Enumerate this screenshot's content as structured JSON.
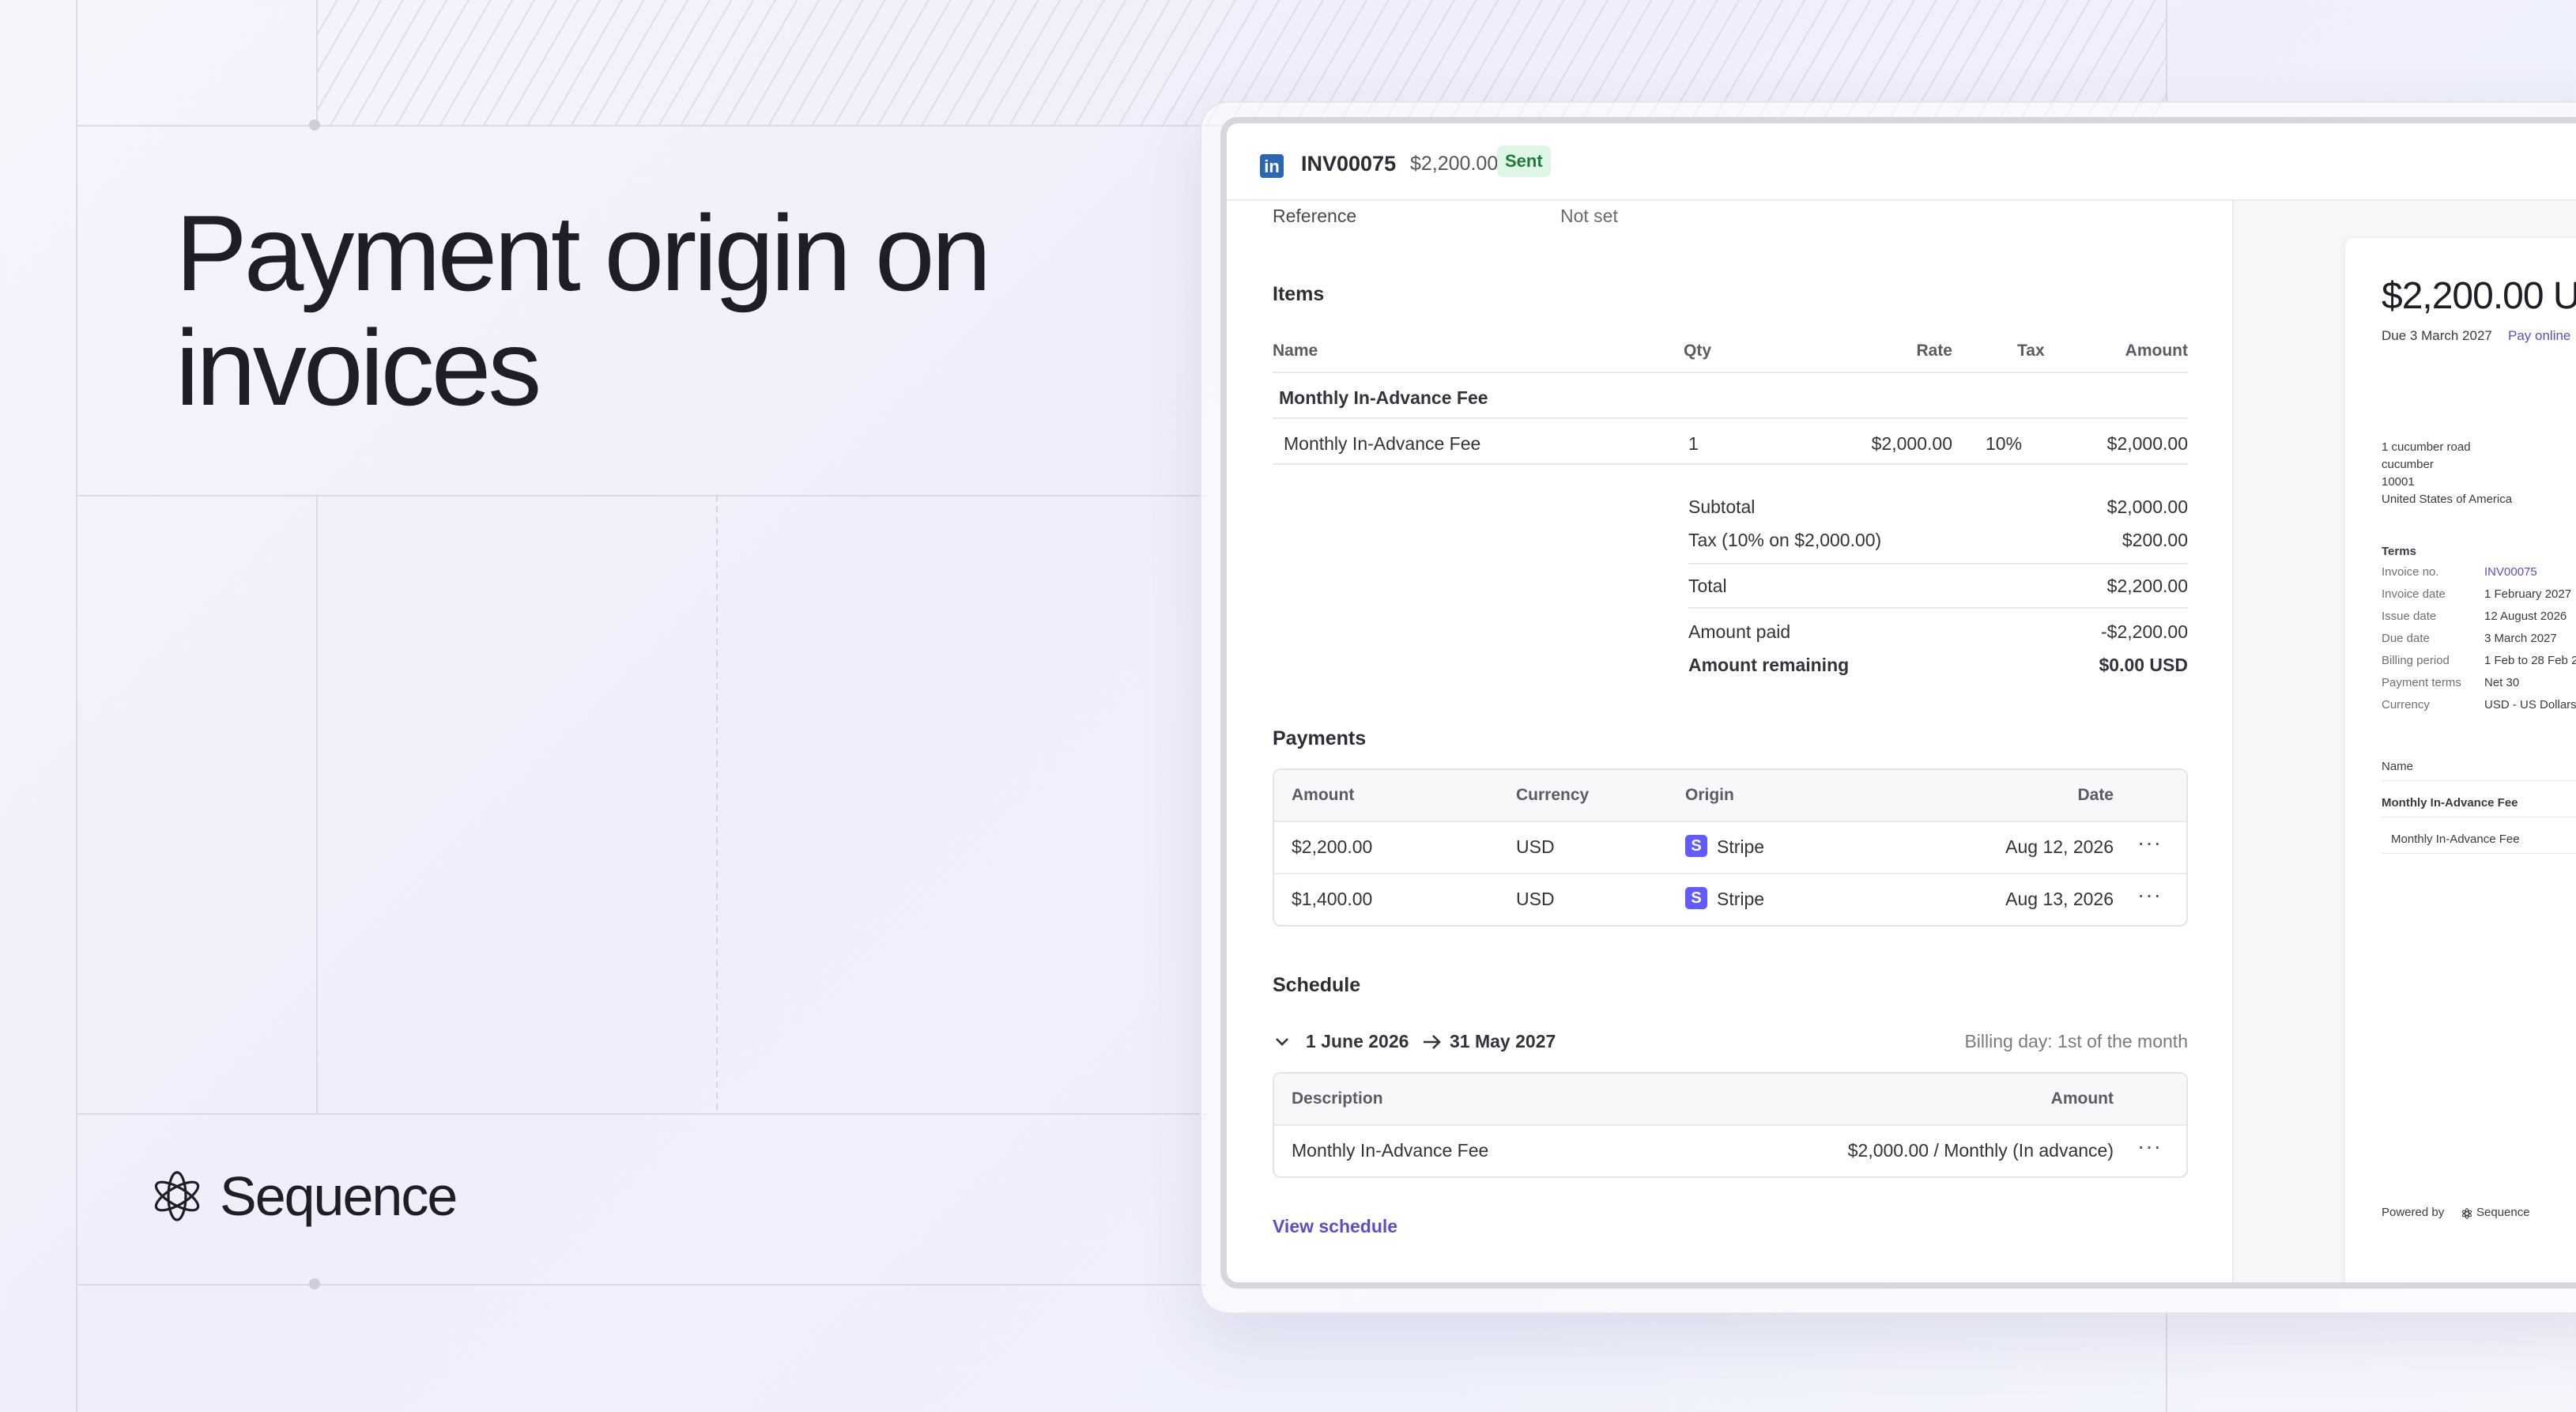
{
  "hero": {
    "title_line1": "Payment origin on",
    "title_line2": "invoices",
    "brand": "Sequence"
  },
  "invoice": {
    "number": "INV00075",
    "amount": "$2,200.00",
    "status": "Sent",
    "status_color": "#1f7a3d",
    "reference_label": "Reference",
    "reference_value": "Not set"
  },
  "items": {
    "heading": "Items",
    "columns": [
      "Name",
      "Qty",
      "Rate",
      "Tax",
      "Amount"
    ],
    "group_label": "Monthly In-Advance Fee",
    "rows": [
      {
        "name": "Monthly In-Advance Fee",
        "qty": "1",
        "rate": "$2,000.00",
        "tax": "10%",
        "amount": "$2,000.00"
      }
    ],
    "subtotal_label": "Subtotal",
    "subtotal_value": "$2,000.00",
    "tax_label": "Tax (10% on $2,000.00)",
    "tax_value": "$200.00",
    "total_label": "Total",
    "total_value": "$2,200.00",
    "paid_label": "Amount paid",
    "paid_value": "-$2,200.00",
    "remaining_label": "Amount remaining",
    "remaining_value": "$0.00 USD"
  },
  "payments": {
    "heading": "Payments",
    "columns": [
      "Amount",
      "Currency",
      "Origin",
      "Date"
    ],
    "rows": [
      {
        "amount": "$2,200.00",
        "currency": "USD",
        "origin": "Stripe",
        "date": "Aug 12, 2026"
      },
      {
        "amount": "$1,400.00",
        "currency": "USD",
        "origin": "Stripe",
        "date": "Aug 13, 2026"
      }
    ],
    "origin_icon": "stripe-icon",
    "stripe_color": "#635bff"
  },
  "schedule": {
    "heading": "Schedule",
    "range_start": "1 June 2026",
    "range_end": "31 May 2027",
    "billing_day": "Billing day: 1st of the month",
    "columns": [
      "Description",
      "Amount"
    ],
    "rows": [
      {
        "description": "Monthly In-Advance Fee",
        "amount": "$2,000.00 / Monthly (In advance)"
      }
    ],
    "view_link": "View schedule"
  },
  "preview": {
    "amount": "$2,200.00 U",
    "due": "Due 3 March 2027",
    "pay_online": "Pay online",
    "address": [
      "1 cucumber road",
      "cucumber",
      "10001",
      "United States of America"
    ],
    "terms_heading": "Terms",
    "terms": [
      {
        "label": "Invoice no.",
        "value": "INV00075"
      },
      {
        "label": "Invoice date",
        "value": "1 February 2027"
      },
      {
        "label": "Issue date",
        "value": "12 August 2026"
      },
      {
        "label": "Due date",
        "value": "3 March 2027"
      },
      {
        "label": "Billing period",
        "value": "1 Feb to 28 Feb 2"
      },
      {
        "label": "Payment terms",
        "value": "Net 30"
      },
      {
        "label": "Currency",
        "value": "USD - US Dollars"
      }
    ],
    "name_heading": "Name",
    "line_group": "Monthly In-Advance Fee",
    "line_item": "Monthly In-Advance Fee",
    "powered_by": "Powered by",
    "powered_brand": "Sequence"
  },
  "colors": {
    "accent": "#5b4fc6",
    "linkedin": "#2d67b2"
  }
}
